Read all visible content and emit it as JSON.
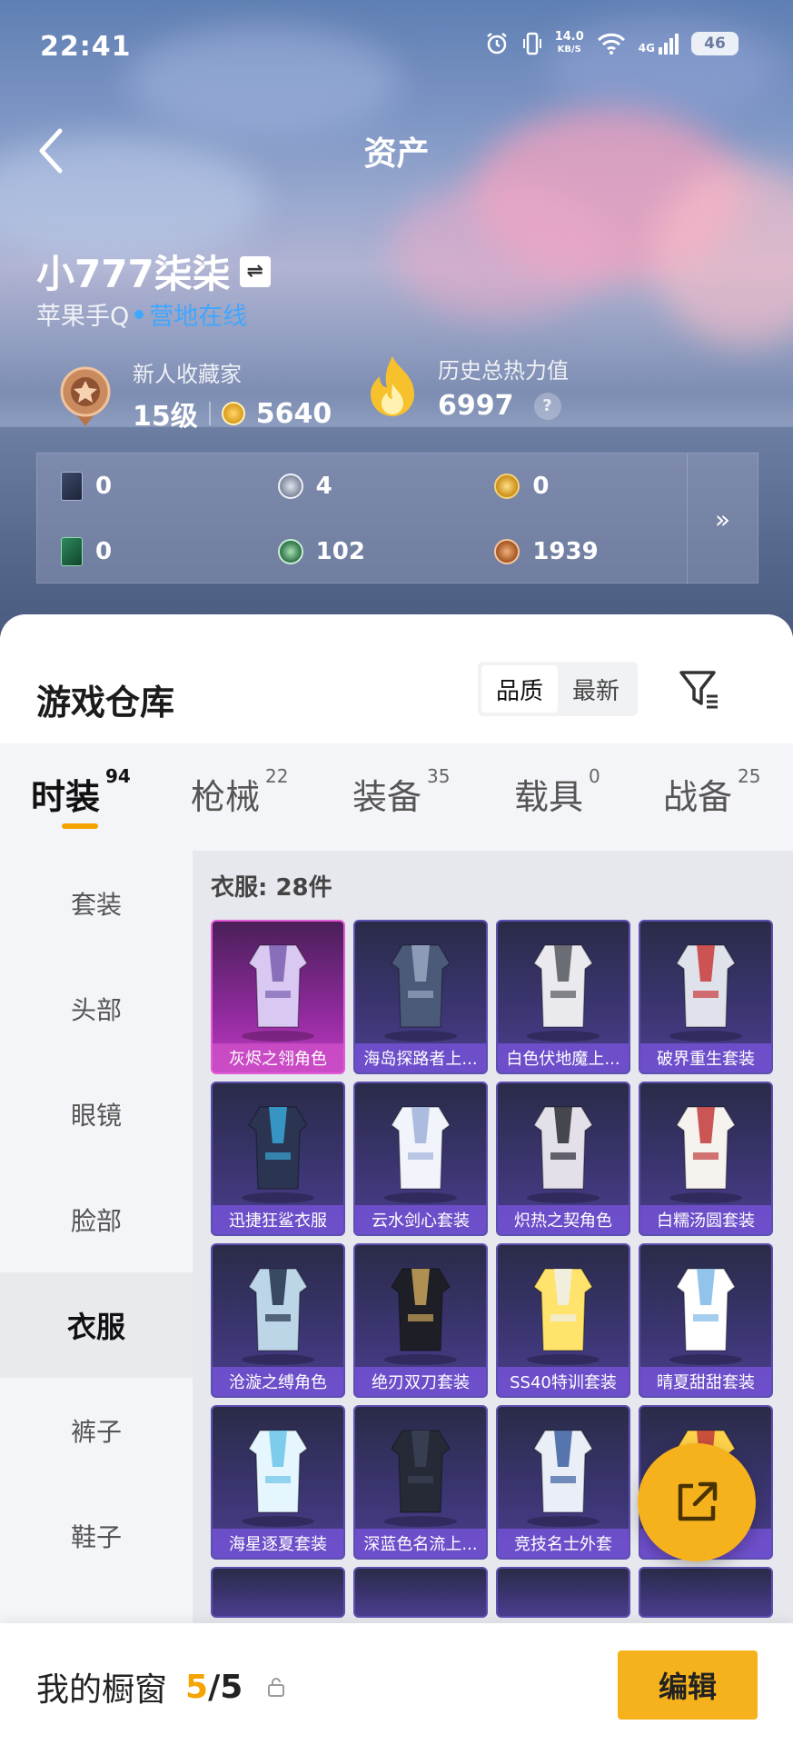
{
  "status_bar": {
    "time": "22:41",
    "net_speed": "14.0",
    "net_unit": "KB/S",
    "signal_label": "4G",
    "battery": "46"
  },
  "header": {
    "title": "资产"
  },
  "profile": {
    "username": "小777柒柒",
    "platform": "苹果手Q",
    "online_status": "营地在线",
    "collector_title": "新人收藏家",
    "collector_level": "15级",
    "collector_points": "5640",
    "heat_label": "历史总热力值",
    "heat_value": "6997",
    "help": "?"
  },
  "currencies": [
    {
      "icon": "dark-card-icon",
      "value": "0"
    },
    {
      "icon": "silver-coin-icon",
      "value": "4"
    },
    {
      "icon": "gold-medal-icon",
      "value": "0"
    },
    {
      "icon": "green-card-icon",
      "value": "0"
    },
    {
      "icon": "green-orb-icon",
      "value": "102"
    },
    {
      "icon": "bronze-coin-icon",
      "value": "1939"
    }
  ],
  "warehouse": {
    "title": "游戏仓库",
    "sort_options": [
      "品质",
      "最新"
    ],
    "sort_selected": "品质"
  },
  "tabs": [
    {
      "label": "时装",
      "count": "94",
      "active": true
    },
    {
      "label": "枪械",
      "count": "22",
      "active": false
    },
    {
      "label": "装备",
      "count": "35",
      "active": false
    },
    {
      "label": "载具",
      "count": "0",
      "active": false
    },
    {
      "label": "战备",
      "count": "25",
      "active": false
    }
  ],
  "sidebar": [
    {
      "label": "套装"
    },
    {
      "label": "头部"
    },
    {
      "label": "眼镜"
    },
    {
      "label": "脸部"
    },
    {
      "label": "衣服",
      "active": true
    },
    {
      "label": "裤子"
    },
    {
      "label": "鞋子"
    }
  ],
  "grid": {
    "header": "衣服: 28件",
    "items": [
      {
        "label": "灰烬之翎角色",
        "highlight": true
      },
      {
        "label": "海岛探路者上..."
      },
      {
        "label": "白色伏地魔上..."
      },
      {
        "label": "破界重生套装"
      },
      {
        "label": "迅捷狂鲨衣服"
      },
      {
        "label": "云水剑心套装"
      },
      {
        "label": "炽热之契角色"
      },
      {
        "label": "白糯汤圆套装"
      },
      {
        "label": "沧漩之缚角色"
      },
      {
        "label": "绝刃双刀套装"
      },
      {
        "label": "SS40特训套装"
      },
      {
        "label": "晴夏甜甜套装"
      },
      {
        "label": "海星逐夏套装"
      },
      {
        "label": "深蓝色名流上..."
      },
      {
        "label": "竞技名士外套"
      },
      {
        "label": "套装"
      }
    ]
  },
  "bottom": {
    "showcase_label": "我的橱窗",
    "showcase_used": "5",
    "showcase_sep": "/",
    "showcase_total": "5",
    "edit_label": "编辑"
  },
  "colors": {
    "accent": "#f5a300",
    "online": "#3fa7ff",
    "item_label": "#7452d6",
    "item_highlight": "#c23bc2"
  }
}
